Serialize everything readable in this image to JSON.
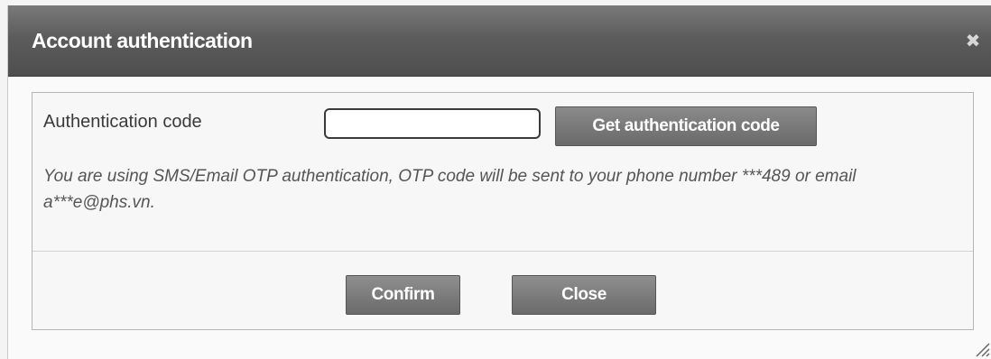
{
  "dialog": {
    "title": "Account authentication",
    "close_icon": "close-icon"
  },
  "form": {
    "code_label": "Authentication code",
    "code_value": "",
    "get_code_label": "Get authentication code",
    "notice": "You are using SMS/Email OTP authentication, OTP code will be sent to your phone number ***489 or email a***e@phs.vn."
  },
  "actions": {
    "confirm_label": "Confirm",
    "close_label": "Close"
  }
}
